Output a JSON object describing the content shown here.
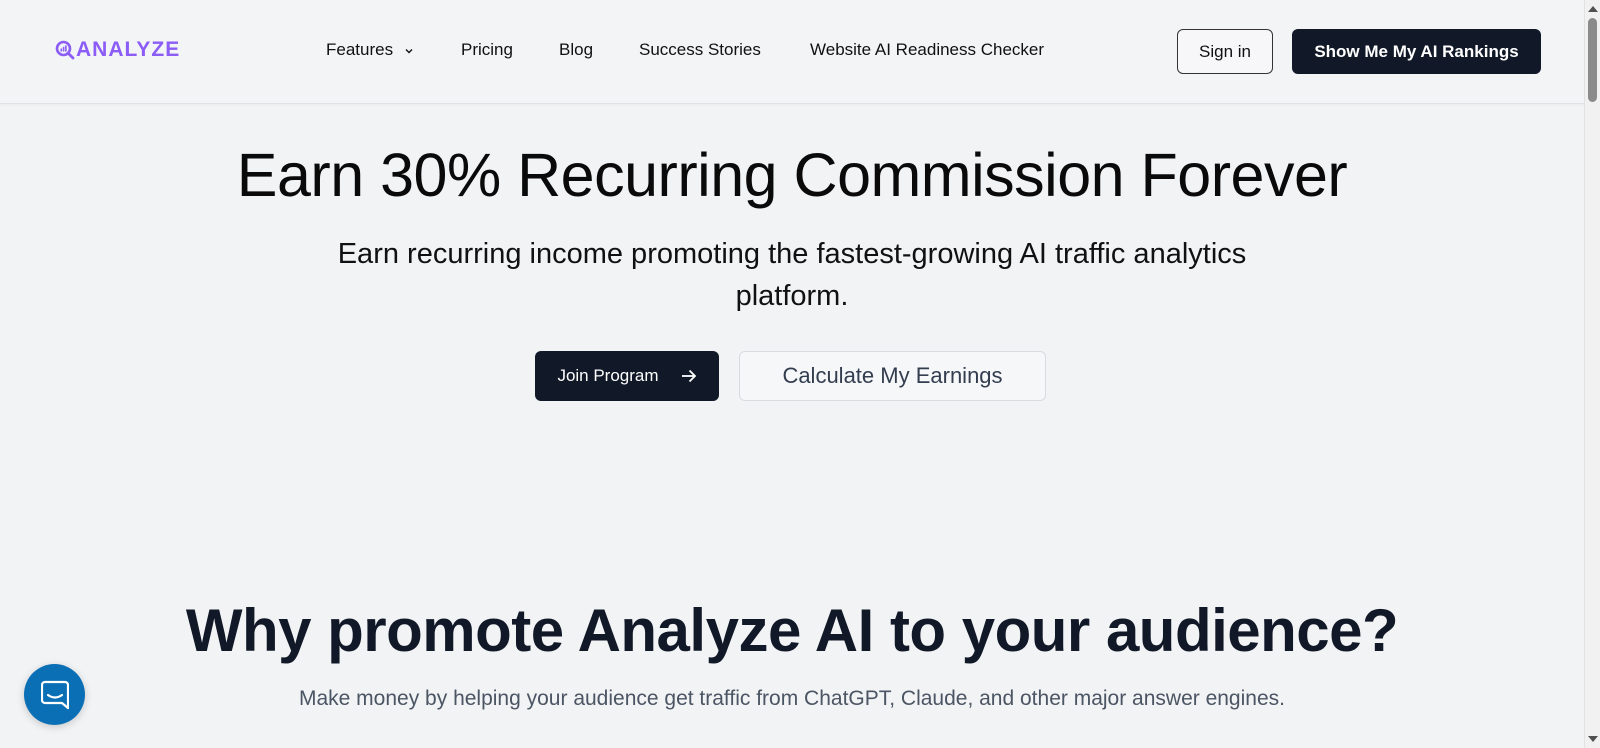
{
  "nav": {
    "logo_text": "ANALYZE",
    "links": [
      {
        "label": "Features"
      },
      {
        "label": "Pricing"
      },
      {
        "label": "Blog"
      },
      {
        "label": "Success Stories"
      },
      {
        "label": "Website AI Readiness Checker"
      }
    ],
    "signin_label": "Sign in",
    "cta_label": "Show Me My AI Rankings"
  },
  "hero": {
    "title": "Earn 30% Recurring Commission Forever",
    "subtitle": "Earn recurring income promoting the fastest-growing AI traffic analytics platform.",
    "primary_button": "Join Program",
    "secondary_button": "Calculate My Earnings"
  },
  "why": {
    "title": "Why promote Analyze AI to your audience?",
    "subtitle": "Make money by helping your audience get traffic from ChatGPT, Claude, and other major answer engines."
  },
  "colors": {
    "brand": "#8b5cf6",
    "dark": "#111827",
    "background": "#f2f3f5",
    "chat": "#0b6fb6"
  },
  "icons": [
    "logo-magnifier-icon",
    "chevron-down-icon",
    "arrow-right-icon",
    "chat-icon"
  ]
}
